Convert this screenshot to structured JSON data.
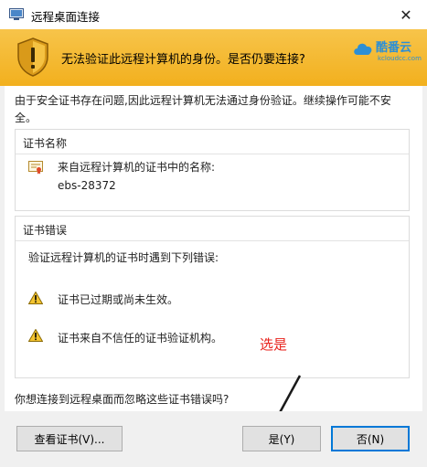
{
  "window": {
    "title": "远程桌面连接",
    "close_glyph": "✕"
  },
  "banner": {
    "message": "无法验证此远程计算机的身份。是否仍要连接?",
    "watermark_name": "酷番云",
    "watermark_sub": "kcloudcc.com"
  },
  "intro": "由于安全证书存在问题,因此远程计算机无法通过身份验证。继续操作可能不安全。",
  "cert_name_section": {
    "title": "证书名称",
    "label": "来自远程计算机的证书中的名称:",
    "name": "ebs-28372"
  },
  "cert_error_section": {
    "title": "证书错误",
    "intro": "验证远程计算机的证书时遇到下列错误:",
    "errors": [
      "证书已过期或尚未生效。",
      "证书来自不信任的证书验证机构。"
    ]
  },
  "annotation": "选是",
  "question": "你想连接到远程桌面而忽略这些证书错误吗?",
  "buttons": {
    "view_cert": "查看证书(V)...",
    "yes": "是(Y)",
    "no": "否(N)"
  },
  "icons": {
    "app": "remote-desktop-icon",
    "shield": "warning-shield-icon",
    "cert": "certificate-icon",
    "warn": "warning-triangle-icon"
  },
  "colors": {
    "banner": "#f2b01e",
    "annotation": "#e8211b",
    "focus": "#0078d7"
  }
}
